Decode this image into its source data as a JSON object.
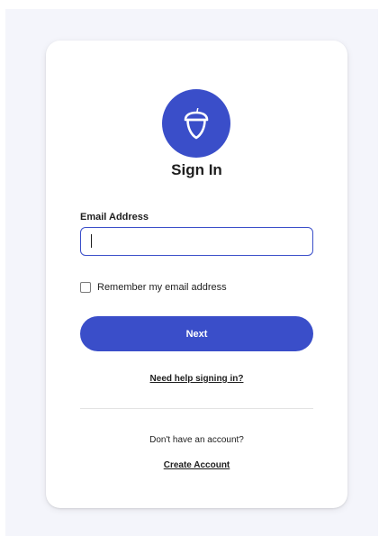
{
  "header": {
    "title": "Sign In",
    "logo_icon": "acorn-icon",
    "logo_color": "#3a4ec9"
  },
  "form": {
    "email_label": "Email Address",
    "email_value": "",
    "remember_label": "Remember my email address",
    "remember_checked": false,
    "next_label": "Next",
    "help_link": "Need help signing in?"
  },
  "footer": {
    "prompt": "Don't have an account?",
    "create_link": "Create Account"
  },
  "colors": {
    "accent": "#3a4ec9",
    "background": "#f4f5fb",
    "card": "#ffffff",
    "text": "#1e1e1e"
  }
}
